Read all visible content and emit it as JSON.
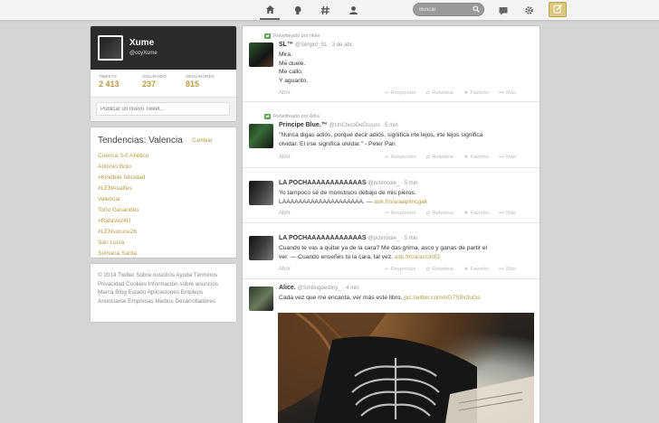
{
  "nav": {
    "search_placeholder": "Buscar",
    "icons": [
      "home-icon",
      "connect-icon",
      "discover-hash-icon",
      "me-icon",
      "messages-icon",
      "gear-icon",
      "compose-icon"
    ]
  },
  "profile": {
    "name": "Xume",
    "handle": "@ccyXume",
    "stats": [
      {
        "label": "TWEETS",
        "value": "2 413"
      },
      {
        "label": "SIGUIENDO",
        "value": "237"
      },
      {
        "label": "SEGUIDORES",
        "value": "815"
      }
    ],
    "compose_placeholder": "Publicar un nuevo Tweet..."
  },
  "trends": {
    "title": "Tendencias: Valencia",
    "change_label": "Cambiar",
    "items": [
      "Cuenca 3-0 Atlético",
      "Antonio Bolo",
      "#Kindbile felicidad",
      "#LENAsalfes",
      "Valencia",
      "Toño Gasandes",
      "#RafaVez4U",
      "#LENsoruce26",
      "San Lucía",
      "Semana Santa"
    ]
  },
  "footer": {
    "text": "© 2014 Twitter  Sobre nosotros  Ayuda  Términos  Privacidad  Cookies  Información sobre anuncios  Marca  Blog  Estado  Aplicaciones  Empleos  Anunciarse  Empresas  Medios  Desarrolladores"
  },
  "actions": {
    "reply": "Responder",
    "retweet": "Retwitear",
    "favorite": "Favorito",
    "more": "Más"
  },
  "tweets": [
    {
      "context": "Retwitteado por rikke",
      "name": "SL™",
      "handle": "@Sergiof_SL · 3 de abr.",
      "lines": [
        "Mira.",
        "Me duele.",
        "Me callo.",
        "Y aguanto."
      ],
      "link": "",
      "open": "Abrir"
    },
    {
      "context": "Retwitteado por Alba",
      "name": "Principe Blue.™",
      "handle": "@UnChicoDeOscuro · 5 min",
      "lines": [
        "\"Nunca digas adiós, porque decir adiós, significa irte lejos, irte lejos significa",
        "olvidar. El irse significa olvidar.\" - Peter Pan"
      ],
      "link": "",
      "open": "Abrir"
    },
    {
      "context": "",
      "name": "LA POCHAAAAAAAAAAAAS",
      "handle": "@pctimsole_ · 5 min",
      "lines": [
        "Yo tampoco sé de monstruos debajo de mis pieros.",
        "LAAAAAAAAAAAAAAAAAAAA. —"
      ],
      "link": "ask.fm/a/aaplincgak",
      "open": "Abrir"
    },
    {
      "context": "",
      "name": "LA POCHAAAAAAAAAAAAS",
      "handle": "@pctimsole_ · 5 min",
      "lines": [
        "Cuando te vas a quitar ya de la cara? Me das grima, asco y ganas de partir el",
        "ver. — Cuando enseñes tú la cara, tal vez."
      ],
      "link": "ask.fm/a/accilr82",
      "open": "Abrir"
    },
    {
      "context": "",
      "name": "Alice.",
      "handle": "@Smilingdestiny_ · 4 min",
      "lines": [
        "Cada vez que me encanta, ver más este libro."
      ],
      "link": "pic.twitter.com/nG7S9x3uGs",
      "open": ""
    }
  ],
  "colors": {
    "accent": "#b89a3d",
    "topbar": "#f4f4f4",
    "background": "#d5d5d5",
    "profile_header": "#2b2b2b",
    "retweet_green": "#5aa34c"
  }
}
